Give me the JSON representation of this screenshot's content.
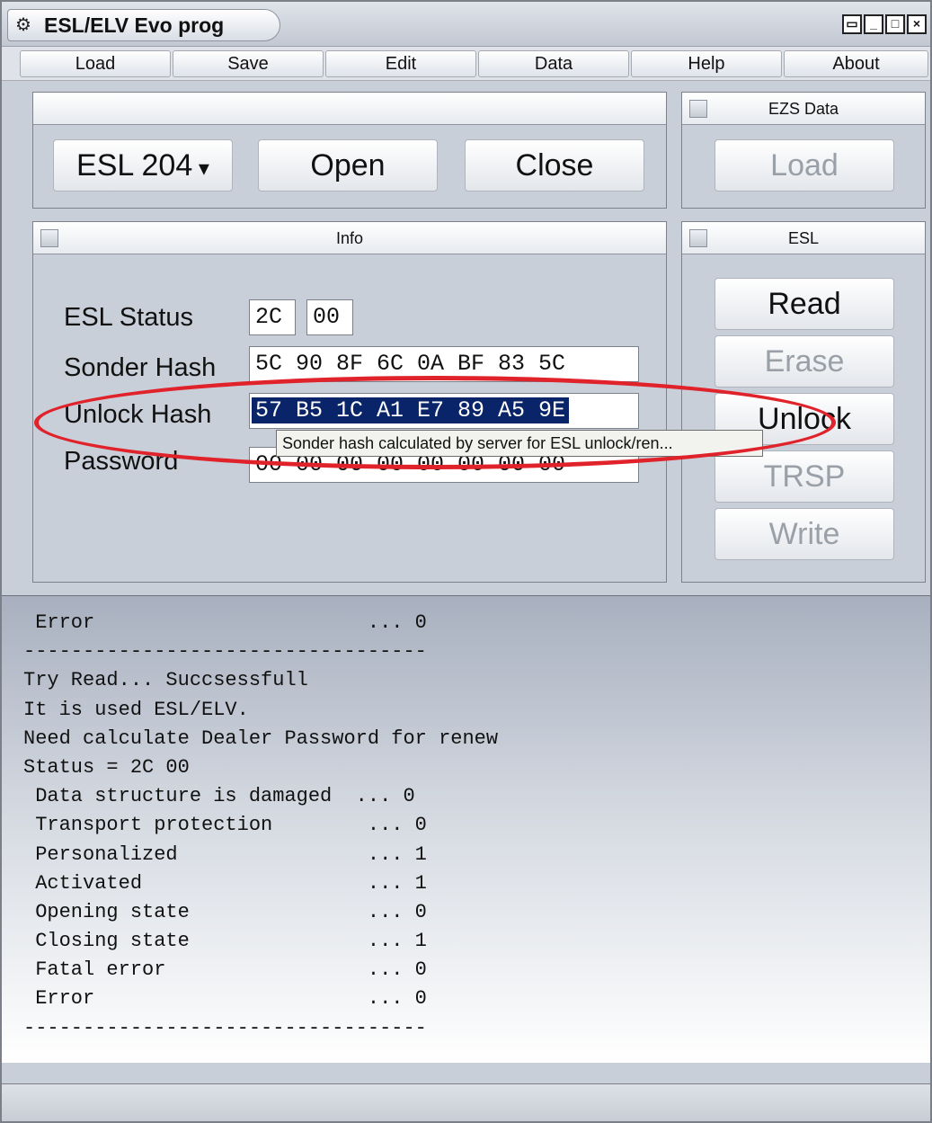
{
  "window": {
    "title": "ESL/ELV Evo prog",
    "icon": "key-gear-icon"
  },
  "window_controls": [
    "restore-icon",
    "minimize-icon",
    "maximize-icon",
    "close-icon"
  ],
  "menu": [
    "Load",
    "Save",
    "Edit",
    "Data",
    "Help",
    "About"
  ],
  "device_panel": {
    "device_select": "ESL 204",
    "open_label": "Open",
    "close_label": "Close"
  },
  "ezs_panel": {
    "title": "EZS Data",
    "load_label": "Load"
  },
  "info_panel": {
    "title": "Info",
    "esl_status_label": "ESL Status",
    "esl_status_1": "2C",
    "esl_status_2": "00",
    "sonder_hash_label": "Sonder Hash",
    "sonder_hash_value": "5C 90 8F 6C 0A BF 83 5C",
    "unlock_hash_label": "Unlock Hash",
    "unlock_hash_value": "57 B5 1C A1 E7 89 A5 9E",
    "password_label": "Password",
    "password_value": "00 00 00 00 00 00 00 00",
    "tooltip": "Sonder hash calculated by server for  ESL unlock/ren..."
  },
  "esl_panel": {
    "title": "ESL",
    "read_label": "Read",
    "erase_label": "Erase",
    "unlock_label": "Unlock",
    "trsp_label": "TRSP",
    "write_label": "Write"
  },
  "log": [
    " Error                       ... 0",
    "----------------------------------",
    "Try Read... Succsessfull",
    "It is used ESL/ELV.",
    "Need calculate Dealer Password for renew",
    "Status = 2C 00",
    " Data structure is damaged  ... 0",
    " Transport protection        ... 0",
    " Personalized                ... 1",
    " Activated                   ... 1",
    " Opening state               ... 0",
    " Closing state               ... 1",
    " Fatal error                 ... 0",
    " Error                       ... 0",
    "----------------------------------"
  ],
  "colors": {
    "highlight_ring": "#e0222a",
    "selection": "#0a246a"
  }
}
